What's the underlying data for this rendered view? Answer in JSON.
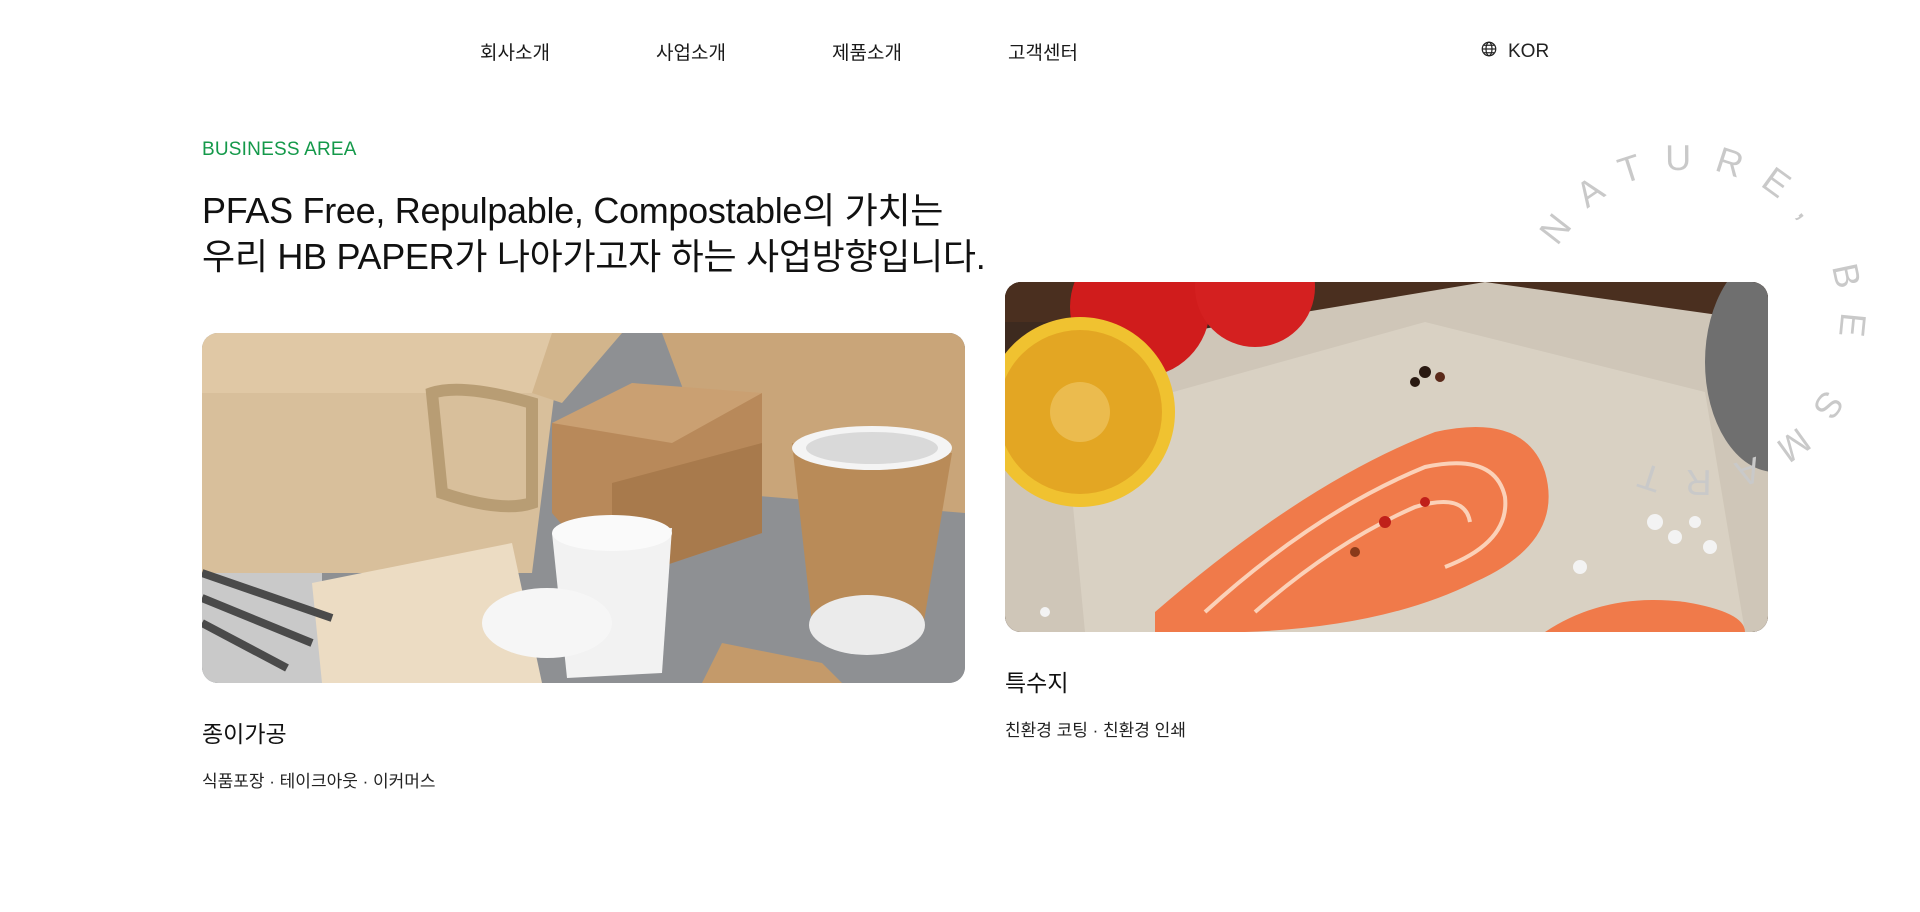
{
  "nav": {
    "items": [
      "회사소개",
      "사업소개",
      "제품소개",
      "고객센터"
    ],
    "lang": "KOR"
  },
  "section": {
    "eyebrow": "BUSINESS AREA",
    "headline_line1": "PFAS Free, Repulpable, Compostable의 가치는",
    "headline_line2": "우리 HB PAPER가 나아가고자 하는 사업방향입니다."
  },
  "cards": [
    {
      "title": "종이가공",
      "desc": "식품포장 · 테이크아웃 · 이커머스"
    },
    {
      "title": "특수지",
      "desc": "친환경 코팅 · 친환경 인쇄"
    }
  ],
  "badge": {
    "text": "NATURE, BE SMART"
  },
  "colors": {
    "accent": "#14994a"
  }
}
